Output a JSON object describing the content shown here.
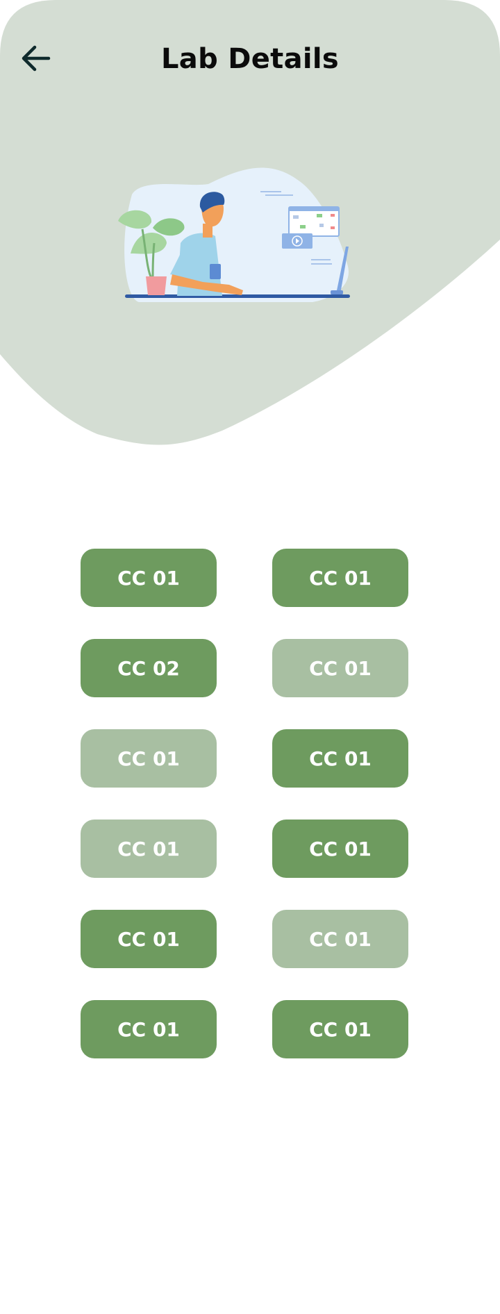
{
  "header": {
    "title": "Lab Details",
    "back_icon": "arrow-left-icon"
  },
  "illustration": {
    "icon": "person-at-computer-illustration"
  },
  "colors": {
    "hero_background": "#d4ddd3",
    "lab_active": "#6e9b5f",
    "lab_inactive": "#a8bfa2",
    "title_text": "#0b0b0b"
  },
  "labs": [
    {
      "label": "CC 01",
      "state": "active"
    },
    {
      "label": "CC 01",
      "state": "active"
    },
    {
      "label": "CC 02",
      "state": "active"
    },
    {
      "label": "CC 01",
      "state": "inactive"
    },
    {
      "label": "CC 01",
      "state": "inactive"
    },
    {
      "label": "CC 01",
      "state": "active"
    },
    {
      "label": "CC 01",
      "state": "inactive"
    },
    {
      "label": "CC 01",
      "state": "active"
    },
    {
      "label": "CC 01",
      "state": "active"
    },
    {
      "label": "CC 01",
      "state": "inactive"
    },
    {
      "label": "CC 01",
      "state": "active"
    },
    {
      "label": "CC 01",
      "state": "active"
    }
  ]
}
